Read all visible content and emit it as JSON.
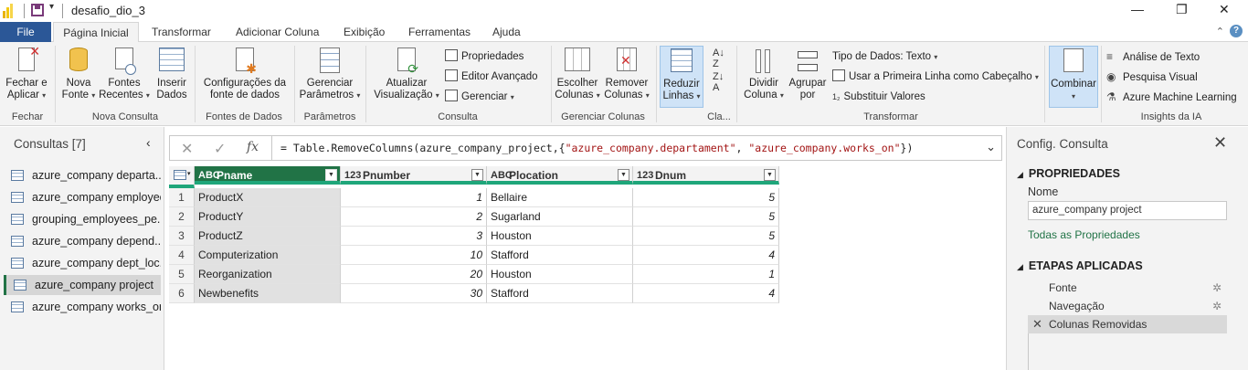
{
  "window": {
    "title": "desafio_dio_3",
    "minimize": "—",
    "restore": "❐",
    "close": "✕"
  },
  "tabs": [
    {
      "label": "File"
    },
    {
      "label": "Página Inicial"
    },
    {
      "label": "Transformar"
    },
    {
      "label": "Adicionar Coluna"
    },
    {
      "label": "Exibição"
    },
    {
      "label": "Ferramentas"
    },
    {
      "label": "Ajuda"
    }
  ],
  "ribbon": {
    "fechar": {
      "btn1": "Fechar e",
      "btn2": "Aplicar",
      "group": "Fechar"
    },
    "nova_consulta": {
      "nova1": "Nova",
      "nova2": "Fonte",
      "recentes1": "Fontes",
      "recentes2": "Recentes",
      "inserir1": "Inserir",
      "inserir2": "Dados",
      "group": "Nova Consulta"
    },
    "fontes": {
      "btn1": "Configurações da",
      "btn2": "fonte de dados",
      "group": "Fontes de Dados"
    },
    "parametros": {
      "btn1": "Gerenciar",
      "btn2": "Parâmetros",
      "group": "Parâmetros"
    },
    "consulta": {
      "atualizar1": "Atualizar",
      "atualizar2": "Visualização",
      "propriedades": "Propriedades",
      "editor": "Editor Avançado",
      "gerenciar": "Gerenciar",
      "group": "Consulta"
    },
    "colunas": {
      "escolher1": "Escolher",
      "escolher2": "Colunas",
      "remover1": "Remover",
      "remover2": "Colunas",
      "group": "Gerenciar Colunas"
    },
    "reduzir": {
      "btn1": "Reduzir",
      "btn2": "Linhas",
      "group": "Cla..."
    },
    "transformar": {
      "dividir1": "Dividir",
      "dividir2": "Coluna",
      "agrupar1": "Agrupar",
      "agrupar2": "por",
      "tipo": "Tipo de Dados: Texto",
      "primeira": "Usar a Primeira Linha como Cabeçalho",
      "substituir": "Substituir Valores",
      "group": "Transformar"
    },
    "combinar": {
      "btn": "Combinar"
    },
    "ia": {
      "texto": "Análise de Texto",
      "visual": "Pesquisa Visual",
      "azureml": "Azure Machine Learning",
      "group": "Insights da IA"
    }
  },
  "queries": {
    "title": "Consultas [7]",
    "items": [
      {
        "label": "azure_company departa..."
      },
      {
        "label": "azure_company employee"
      },
      {
        "label": "grouping_employees_pe..."
      },
      {
        "label": "azure_company depend..."
      },
      {
        "label": "azure_company dept_loc..."
      },
      {
        "label": "azure_company project"
      },
      {
        "label": "azure_company works_on"
      }
    ]
  },
  "formula": {
    "prefix": "= Table.RemoveColumns(azure_company_project,{",
    "str1": "\"azure_company.departament\"",
    "mid": ", ",
    "str2": "\"azure_company.works_on\"",
    "suffix": "})"
  },
  "table": {
    "columns": [
      {
        "type": "ABC",
        "name": "Pname"
      },
      {
        "type": "123",
        "name": "Pnumber"
      },
      {
        "type": "ABC",
        "name": "Plocation"
      },
      {
        "type": "123",
        "name": "Dnum"
      }
    ],
    "rows": [
      {
        "n": "1",
        "Pname": "ProductX",
        "Pnumber": "1",
        "Plocation": "Bellaire",
        "Dnum": "5"
      },
      {
        "n": "2",
        "Pname": "ProductY",
        "Pnumber": "2",
        "Plocation": "Sugarland",
        "Dnum": "5"
      },
      {
        "n": "3",
        "Pname": "ProductZ",
        "Pnumber": "3",
        "Plocation": "Houston",
        "Dnum": "5"
      },
      {
        "n": "4",
        "Pname": "Computerization",
        "Pnumber": "10",
        "Plocation": "Stafford",
        "Dnum": "4"
      },
      {
        "n": "5",
        "Pname": "Reorganization",
        "Pnumber": "20",
        "Plocation": "Houston",
        "Dnum": "1"
      },
      {
        "n": "6",
        "Pname": "Newbenefits",
        "Pnumber": "30",
        "Plocation": "Stafford",
        "Dnum": "4"
      }
    ]
  },
  "settings": {
    "title": "Config. Consulta",
    "propriedades": "PROPRIEDADES",
    "nome_label": "Nome",
    "nome_value": "azure_company project",
    "todas": "Todas as Propriedades",
    "etapas": "ETAPAS APLICADAS",
    "steps": [
      {
        "label": "Fonte"
      },
      {
        "label": "Navegação"
      },
      {
        "label": "Colunas Removidas"
      }
    ]
  },
  "colors": {
    "accent_green": "#217346",
    "header_bar": "#1fa67a",
    "file_tab": "#2b5797"
  }
}
